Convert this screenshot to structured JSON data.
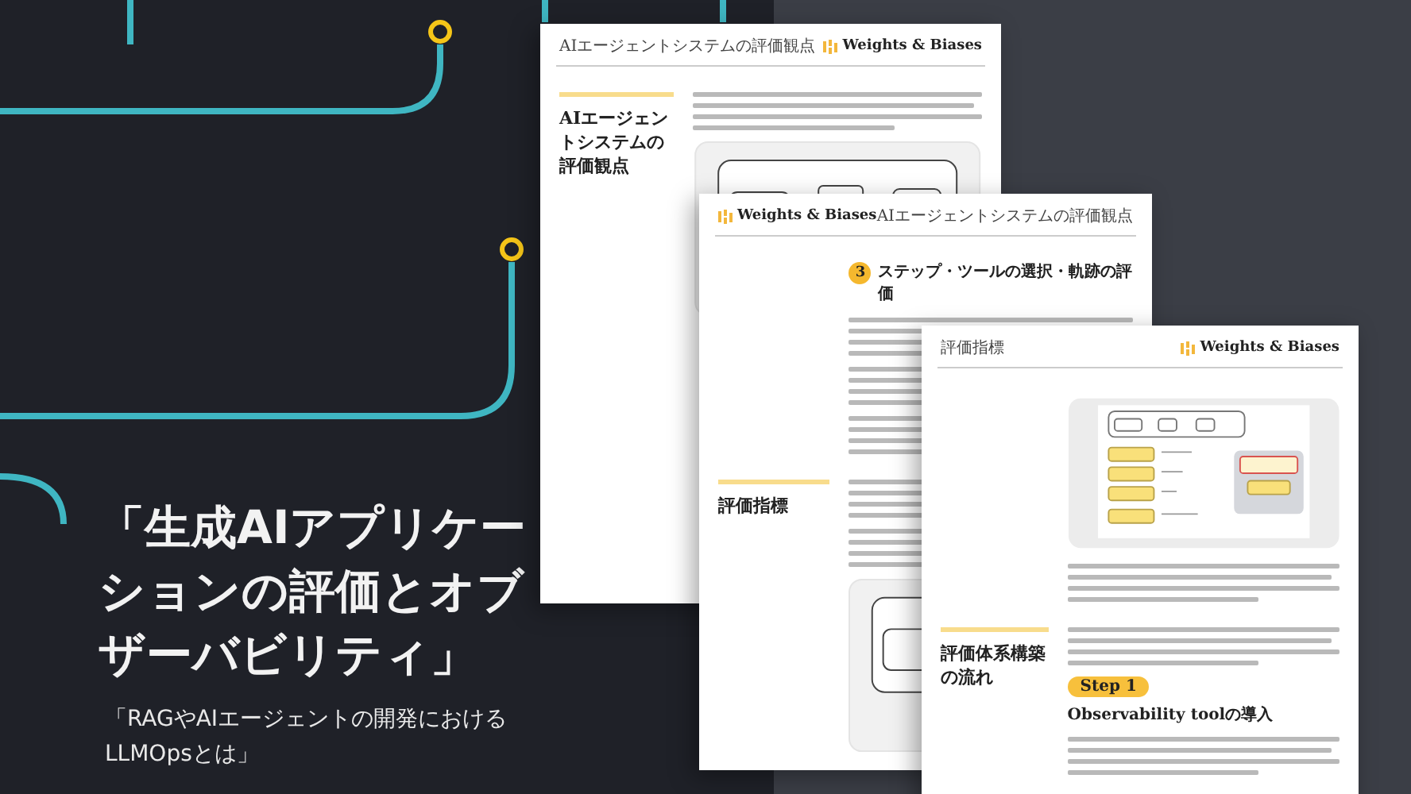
{
  "headline": {
    "title": "「生成AIアプリケーションの評価とオブザーバビリティ」",
    "subtitle": "「RAGやAIエージェントの開発における LLMOpsとは」"
  },
  "pages": [
    {
      "header_items": [
        {
          "kind": "label",
          "text": "AIエージェントシステムの評価観点"
        },
        {
          "kind": "logo",
          "text": "Weights & Biases"
        }
      ],
      "sections": [
        {
          "title": "AIエージェントシステムの評価観点",
          "blocks": [
            {
              "kind": "paragraph"
            },
            {
              "kind": "flow_figure"
            }
          ]
        }
      ]
    },
    {
      "header_items": [
        {
          "kind": "logo",
          "text": "Weights & Biases"
        },
        {
          "kind": "label",
          "text": "AIエージェントシステムの評価観点"
        }
      ],
      "sections": [
        {
          "blocks": [
            {
              "kind": "numbered_heading",
              "number": "3",
              "text": "ステップ・ツールの選択・軌跡の評価"
            },
            {
              "kind": "paragraph"
            },
            {
              "kind": "paragraph"
            },
            {
              "kind": "paragraph"
            }
          ]
        },
        {
          "title": "評価指標",
          "blocks": [
            {
              "kind": "paragraph"
            },
            {
              "kind": "paragraph"
            },
            {
              "kind": "flow_figure"
            }
          ]
        }
      ]
    },
    {
      "header_items": [
        {
          "kind": "label",
          "text": "評価指標"
        },
        {
          "kind": "logo",
          "text": "Weights & Biases"
        }
      ],
      "sections": [
        {
          "blocks": [
            {
              "kind": "metrics_figure"
            },
            {
              "kind": "paragraph"
            }
          ]
        },
        {
          "title": "評価体系構築の流れ",
          "blocks": [
            {
              "kind": "paragraph"
            },
            {
              "kind": "step",
              "badge": "Step 1",
              "text": "Observability toolの導入"
            },
            {
              "kind": "paragraph"
            }
          ]
        }
      ]
    }
  ]
}
